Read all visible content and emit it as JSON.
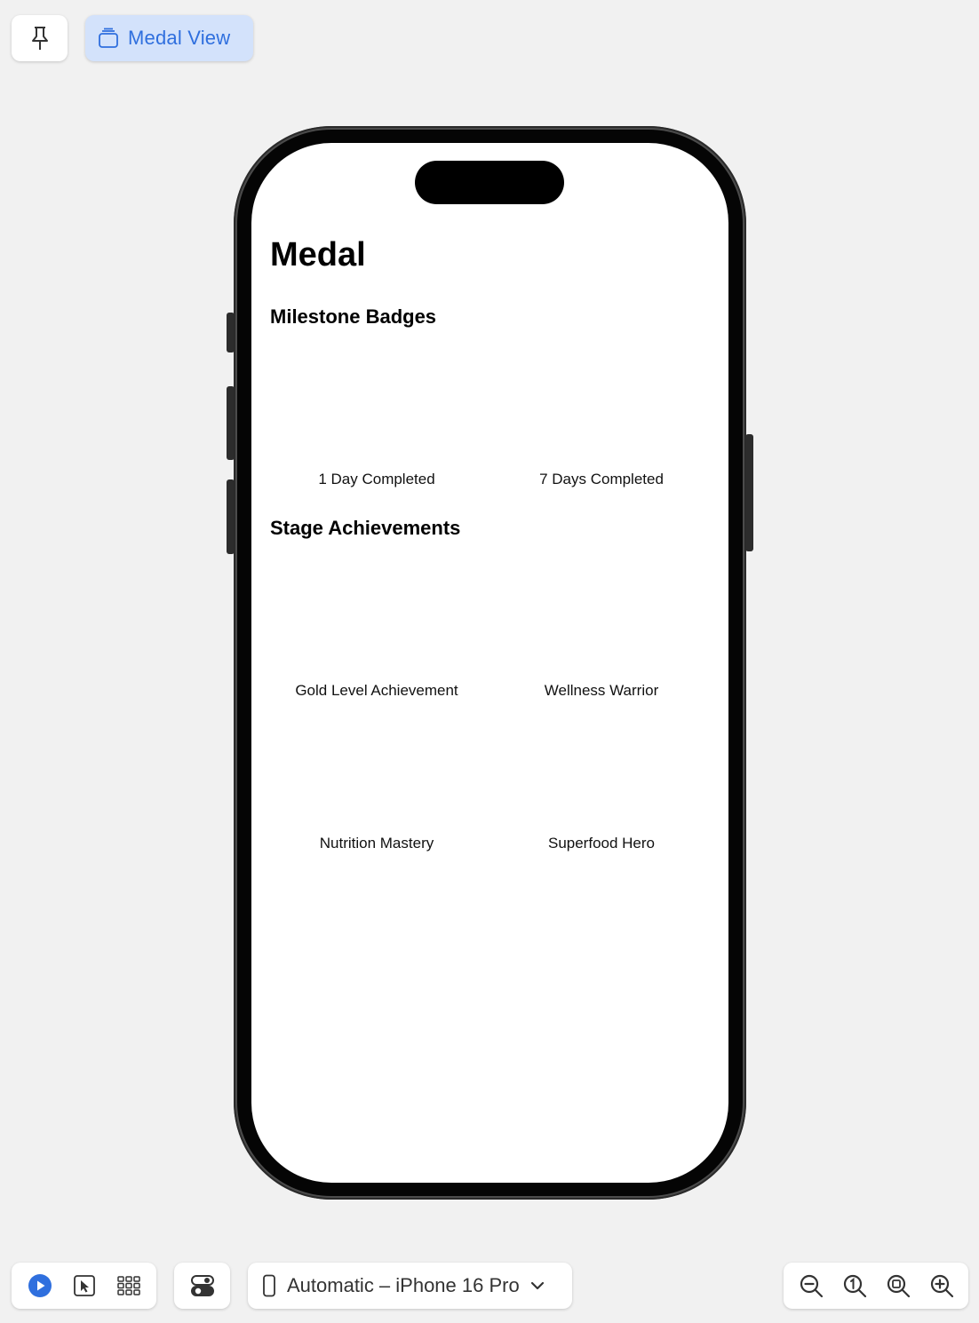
{
  "toolbar": {
    "pin_icon": "pin-icon",
    "tab_label": "Medal View",
    "tab_icon": "stack-icon"
  },
  "screen": {
    "title": "Medal",
    "sections": [
      {
        "heading": "Milestone Badges",
        "items": [
          "1 Day Completed",
          "7 Days Completed"
        ]
      },
      {
        "heading": "Stage Achievements",
        "items": [
          "Gold Level Achievement",
          "Wellness Warrior",
          "Nutrition Mastery",
          "Superfood Hero"
        ]
      }
    ]
  },
  "bottom_bar": {
    "mode_icons": [
      "play-icon",
      "cursor-icon",
      "grid-icon"
    ],
    "toggle_icon": "switches-icon",
    "device_label": "Automatic – iPhone 16 Pro",
    "device_icon": "iphone-icon",
    "zoom_icons": [
      "zoom-out-icon",
      "zoom-actual-icon",
      "zoom-fit-icon",
      "zoom-in-icon"
    ]
  },
  "colors": {
    "accent": "#2f6fde",
    "tab_background": "#d3e2fb",
    "canvas_background": "#f1f1f1"
  }
}
